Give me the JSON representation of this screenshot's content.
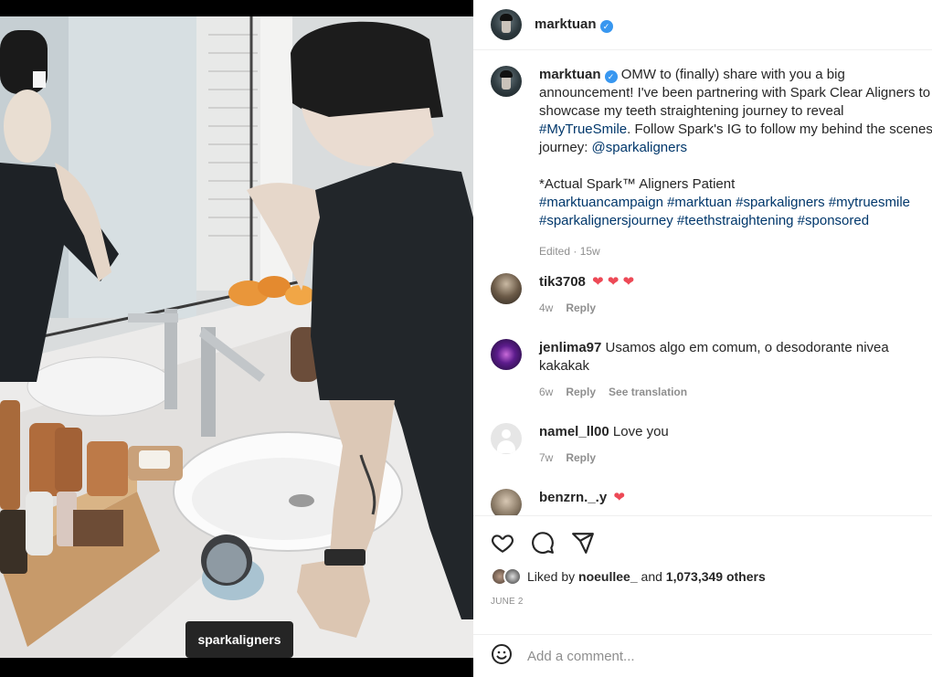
{
  "post": {
    "username": "marktuan",
    "photo_tag": "sparkaligners",
    "caption": {
      "username": "marktuan",
      "line1": "OMW to (finally) share with you a big",
      "line2": "announcement! I've been partnering with Spark Clear Aligners to",
      "line3": "showcase my teeth straightening journey to reveal",
      "hashtag_main": "#MyTrueSmile",
      "line4_rest": ". Follow Spark's IG to follow my behind the scenes",
      "line5_pre": "journey: ",
      "mention": "@sparkaligners",
      "disclaimer": "*Actual Spark™ Aligners Patient",
      "tags_line1": "#marktuancampaign #marktuan #sparkaligners #mytruesmile",
      "tags_line2": "#sparkalignersjourney #teethstraightening #sponsored",
      "meta": "Edited · 15w"
    },
    "comments": [
      {
        "username": "tik3708",
        "text": "",
        "hearts": "❤ ❤ ❤",
        "time": "4w",
        "reply": "Reply"
      },
      {
        "username": "jenlima97",
        "text": "Usamos algo em comum, o desodorante nivea",
        "text2": "kakakak",
        "time": "6w",
        "reply": "Reply",
        "translate": "See translation"
      },
      {
        "username": "namel_ll00",
        "text": "Love you",
        "time": "7w",
        "reply": "Reply"
      },
      {
        "username": "benzrn._.y",
        "hearts": "❤"
      }
    ],
    "likes": {
      "prefix": "Liked by ",
      "user": "noeullee_",
      "and": " and ",
      "count": "1,073,349 others"
    },
    "date": "JUNE 2",
    "add_comment_placeholder": "Add a comment..."
  },
  "icons": {
    "like": "heart-outline-icon",
    "comment": "comment-bubble-icon",
    "share": "paper-plane-icon",
    "emoji": "emoji-smile-icon",
    "verified": "verified-badge-icon"
  },
  "colors": {
    "link": "#00376b",
    "verified": "#3897f0",
    "heart": "#ed4956",
    "muted": "#8e8e8e"
  }
}
